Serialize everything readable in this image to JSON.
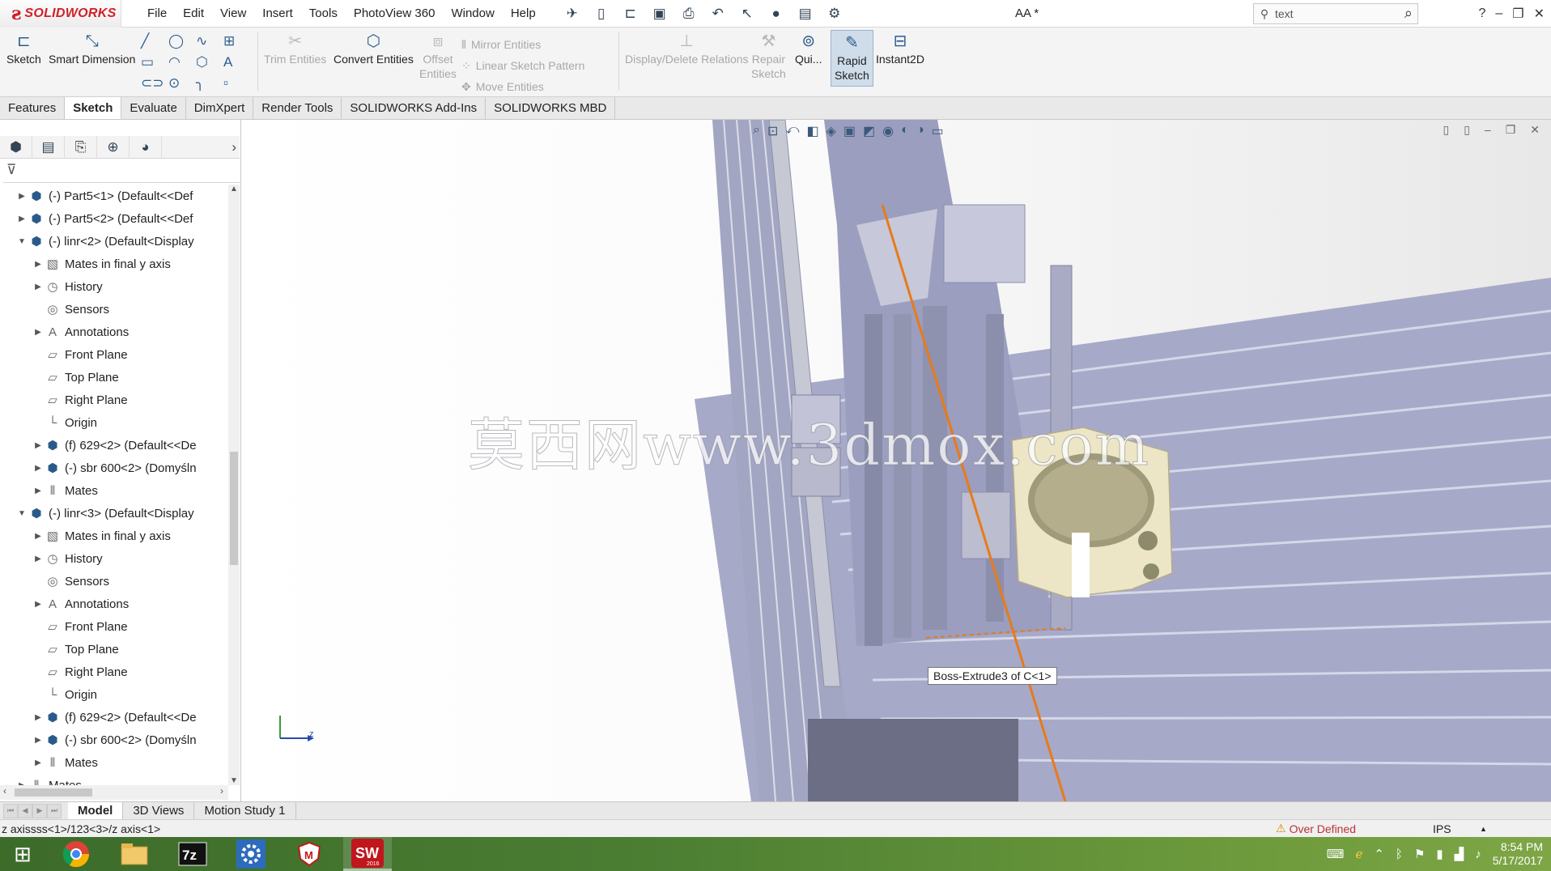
{
  "app": {
    "brand": "SOLIDWORKS",
    "doc_title": "AA *"
  },
  "menu": [
    "File",
    "Edit",
    "View",
    "Insert",
    "Tools",
    "PhotoView 360",
    "Window",
    "Help"
  ],
  "search": {
    "value": "text"
  },
  "toolbar": {
    "sketch": "Sketch",
    "smart_dimension": "Smart Dimension",
    "trim_entities": "Trim Entities",
    "convert_entities": "Convert Entities",
    "offset_entities_1": "Offset",
    "offset_entities_2": "Entities",
    "mirror_entities": "Mirror Entities",
    "linear_sketch_pattern": "Linear Sketch Pattern",
    "move_entities": "Move Entities",
    "display_delete_relations": "Display/Delete Relations",
    "repair_sketch_1": "Repair",
    "repair_sketch_2": "Sketch",
    "quick_snaps": "Qui...",
    "rapid_sketch_1": "Rapid",
    "rapid_sketch_2": "Sketch",
    "instant2d": "Instant2D"
  },
  "tabs": [
    "Features",
    "Sketch",
    "Evaluate",
    "DimXpert",
    "Render Tools",
    "SOLIDWORKS Add-Ins",
    "SOLIDWORKS MBD"
  ],
  "tree": [
    {
      "label": "(-) Part5<1> (Default<<Def",
      "indent": 0,
      "expander": "right",
      "icon": "assembly"
    },
    {
      "label": "(-) Part5<2> (Default<<Def",
      "indent": 0,
      "expander": "right",
      "icon": "assembly"
    },
    {
      "label": "(-) linr<2> (Default<Display",
      "indent": 0,
      "expander": "down",
      "icon": "assembly"
    },
    {
      "label": "Mates in final y axis",
      "indent": 1,
      "expander": "right",
      "icon": "folder"
    },
    {
      "label": "History",
      "indent": 1,
      "expander": "right",
      "icon": "history"
    },
    {
      "label": "Sensors",
      "indent": 1,
      "expander": "",
      "icon": "sensor"
    },
    {
      "label": "Annotations",
      "indent": 1,
      "expander": "right",
      "icon": "annotation"
    },
    {
      "label": "Front Plane",
      "indent": 1,
      "expander": "",
      "icon": "plane"
    },
    {
      "label": "Top Plane",
      "indent": 1,
      "expander": "",
      "icon": "plane"
    },
    {
      "label": "Right Plane",
      "indent": 1,
      "expander": "",
      "icon": "plane"
    },
    {
      "label": "Origin",
      "indent": 1,
      "expander": "",
      "icon": "origin"
    },
    {
      "label": "(f) 629<2> (Default<<De",
      "indent": 1,
      "expander": "right",
      "icon": "assembly"
    },
    {
      "label": "(-) sbr 600<2> (Domyśln",
      "indent": 1,
      "expander": "right",
      "icon": "assembly"
    },
    {
      "label": "Mates",
      "indent": 1,
      "expander": "right",
      "icon": "mates"
    },
    {
      "label": "(-) linr<3> (Default<Display",
      "indent": 0,
      "expander": "down",
      "icon": "assembly"
    },
    {
      "label": "Mates in final y axis",
      "indent": 1,
      "expander": "right",
      "icon": "folder"
    },
    {
      "label": "History",
      "indent": 1,
      "expander": "right",
      "icon": "history"
    },
    {
      "label": "Sensors",
      "indent": 1,
      "expander": "",
      "icon": "sensor"
    },
    {
      "label": "Annotations",
      "indent": 1,
      "expander": "right",
      "icon": "annotation"
    },
    {
      "label": "Front Plane",
      "indent": 1,
      "expander": "",
      "icon": "plane"
    },
    {
      "label": "Top Plane",
      "indent": 1,
      "expander": "",
      "icon": "plane"
    },
    {
      "label": "Right Plane",
      "indent": 1,
      "expander": "",
      "icon": "plane"
    },
    {
      "label": "Origin",
      "indent": 1,
      "expander": "",
      "icon": "origin"
    },
    {
      "label": "(f) 629<2> (Default<<De",
      "indent": 1,
      "expander": "right",
      "icon": "assembly"
    },
    {
      "label": "(-) sbr 600<2> (Domyśln",
      "indent": 1,
      "expander": "right",
      "icon": "assembly"
    },
    {
      "label": "Mates",
      "indent": 1,
      "expander": "right",
      "icon": "mates"
    },
    {
      "label": "Mates",
      "indent": 0,
      "expander": "right",
      "icon": "mates"
    }
  ],
  "viewport": {
    "watermark": "莫西网www.3dmox.com",
    "tooltip": "Boss-Extrude3 of C<1>",
    "triad_label": "z"
  },
  "bottom_tabs": [
    "Model",
    "3D Views",
    "Motion Study 1"
  ],
  "status": {
    "message": "z axissss<1>/123<3>/z axis<1>",
    "overdefined": "Over Defined",
    "units": "IPS"
  },
  "taskbar": {
    "apps": [
      "windows-start",
      "chrome",
      "file-explorer",
      "7zip",
      "settings",
      "mcafee",
      "solidworks-2016"
    ],
    "time": "8:54 PM",
    "date": "5/17/2017",
    "sw_year": "2016"
  },
  "colors": {
    "brand_red": "#d0202a",
    "tooltip_border": "#777777",
    "overdefined": "#bb3333",
    "profile_blue_gray": "#a7a9c8",
    "part_cream": "#e8e2c0",
    "sketch_orange": "#e87a1a"
  }
}
